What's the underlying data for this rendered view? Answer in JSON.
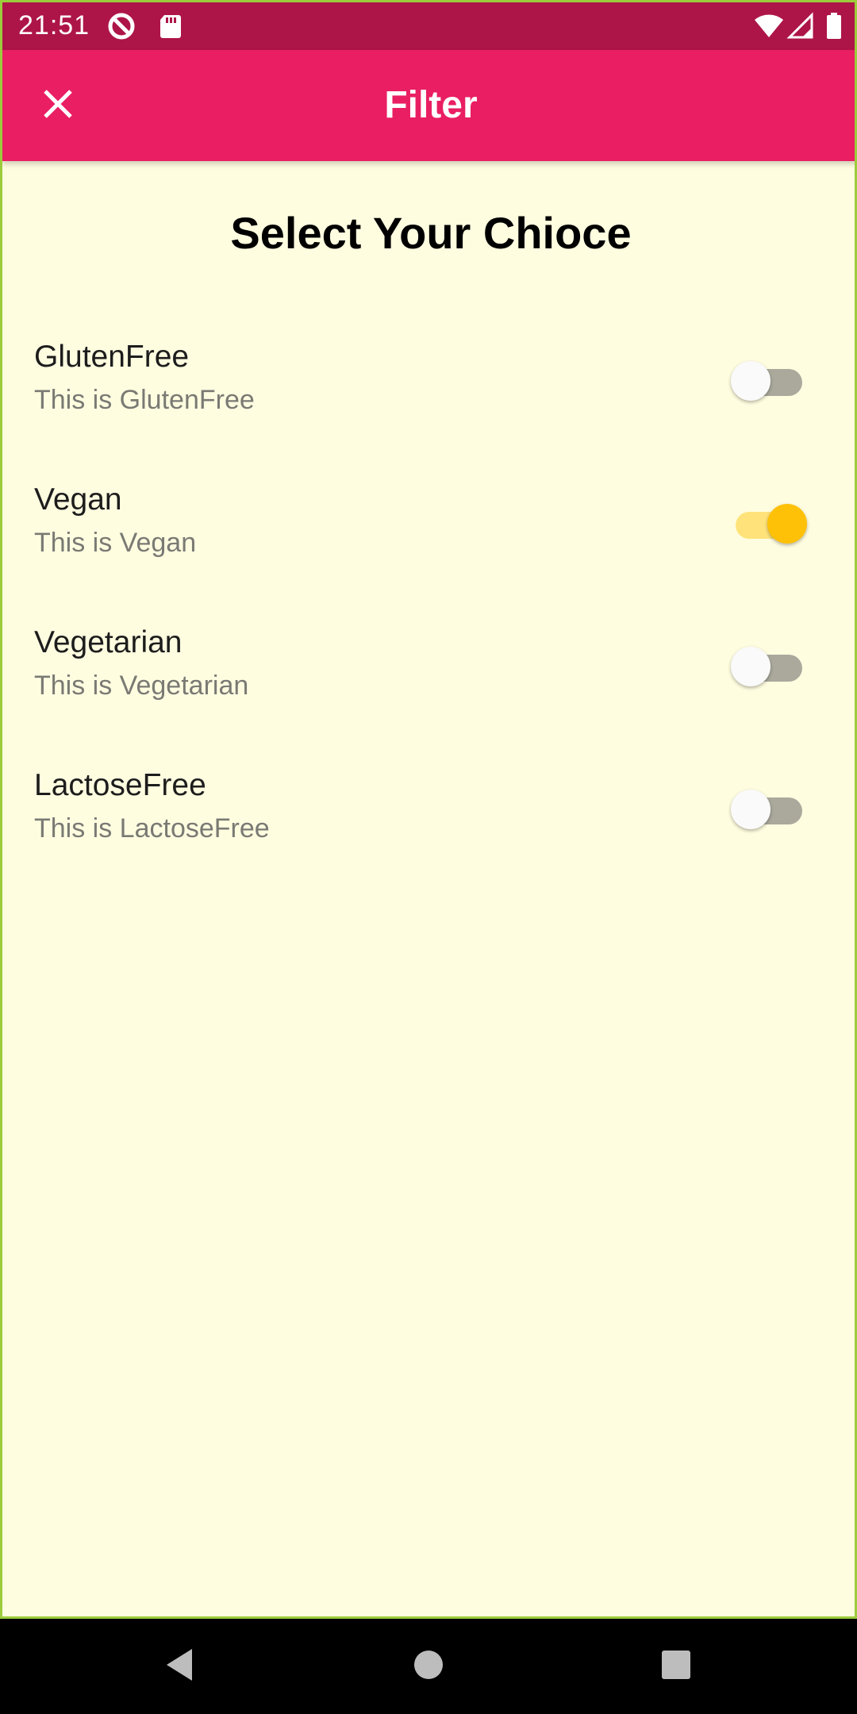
{
  "status_bar": {
    "time": "21:51",
    "icons": [
      "do-not-disturb-icon",
      "sd-card-icon",
      "wifi-icon",
      "signal-icon",
      "battery-icon"
    ]
  },
  "app_bar": {
    "title": "Filter",
    "close_icon": "close-icon",
    "background": "#e91e63"
  },
  "heading": "Select Your Chioce",
  "filters": [
    {
      "title": "GlutenFree",
      "subtitle": "This is GlutenFree",
      "enabled": false
    },
    {
      "title": "Vegan",
      "subtitle": "This is Vegan",
      "enabled": true
    },
    {
      "title": "Vegetarian",
      "subtitle": "This is Vegetarian",
      "enabled": false
    },
    {
      "title": "LactoseFree",
      "subtitle": "This is LactoseFree",
      "enabled": false
    }
  ],
  "colors": {
    "status_bar": "#ad1548",
    "background": "#fffde0",
    "switch_on": "#ffc107"
  },
  "nav_bar": {
    "icons": [
      "back-icon",
      "home-icon",
      "recents-icon"
    ]
  }
}
